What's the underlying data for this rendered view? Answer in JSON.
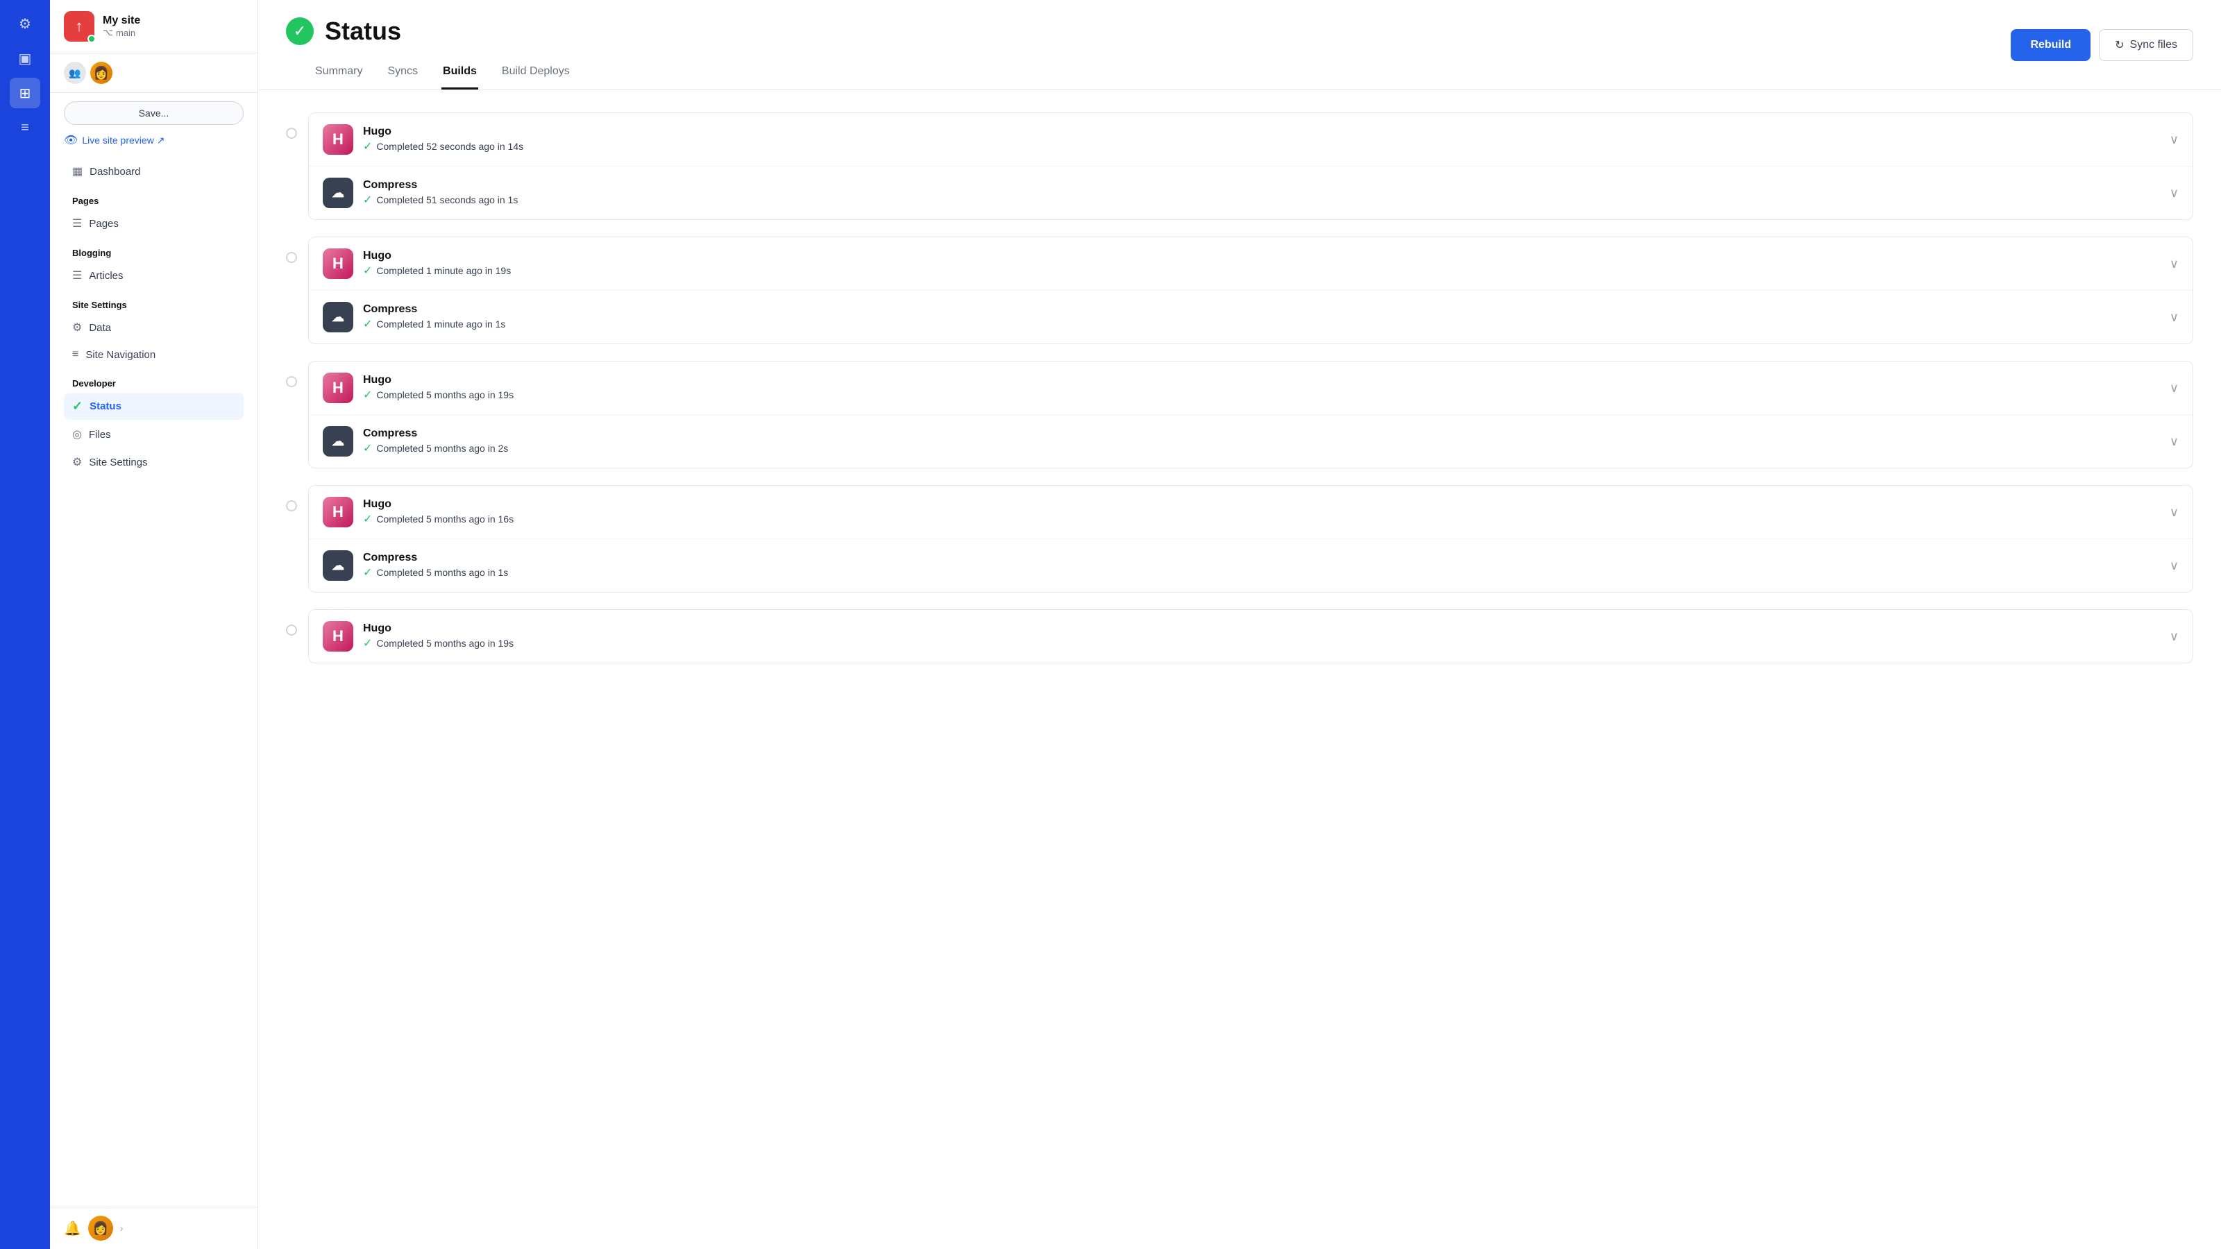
{
  "iconBar": {
    "items": [
      {
        "name": "gear-icon",
        "symbol": "⚙",
        "active": false
      },
      {
        "name": "layout-icon",
        "symbol": "▣",
        "active": false
      },
      {
        "name": "grid-icon",
        "symbol": "⊞",
        "active": true
      },
      {
        "name": "chart-icon",
        "symbol": "≡",
        "active": false
      }
    ]
  },
  "sidebar": {
    "siteName": "My site",
    "siteBranch": "main",
    "saveLabel": "Save...",
    "livePreviewLabel": "Live site preview ↗",
    "navSections": [
      {
        "label": "",
        "items": [
          {
            "name": "dashboard",
            "icon": "▦",
            "label": "Dashboard",
            "active": false
          }
        ]
      },
      {
        "label": "Pages",
        "items": [
          {
            "name": "pages",
            "icon": "☰",
            "label": "Pages",
            "active": false
          }
        ]
      },
      {
        "label": "Blogging",
        "items": [
          {
            "name": "articles",
            "icon": "☰",
            "label": "Articles",
            "active": false
          }
        ]
      },
      {
        "label": "Site Settings",
        "items": [
          {
            "name": "data",
            "icon": "⚙",
            "label": "Data",
            "active": false
          },
          {
            "name": "site-navigation",
            "icon": "≡",
            "label": "Site Navigation",
            "active": false
          }
        ]
      },
      {
        "label": "Developer",
        "items": [
          {
            "name": "status",
            "icon": "✓",
            "label": "Status",
            "active": true
          },
          {
            "name": "files",
            "icon": "◎",
            "label": "Files",
            "active": false
          },
          {
            "name": "site-settings",
            "icon": "⚙",
            "label": "Site Settings",
            "active": false
          }
        ]
      }
    ]
  },
  "header": {
    "pageTitle": "Status",
    "rebuildLabel": "Rebuild",
    "syncFilesLabel": "Sync files"
  },
  "tabs": [
    {
      "label": "Summary",
      "active": false
    },
    {
      "label": "Syncs",
      "active": false
    },
    {
      "label": "Builds",
      "active": true
    },
    {
      "label": "Build Deploys",
      "active": false
    }
  ],
  "builds": [
    {
      "steps": [
        {
          "type": "hugo",
          "name": "Hugo",
          "status": "Completed 52 seconds ago in 14s"
        },
        {
          "type": "compress",
          "name": "Compress",
          "status": "Completed 51 seconds ago in 1s"
        }
      ]
    },
    {
      "steps": [
        {
          "type": "hugo",
          "name": "Hugo",
          "status": "Completed 1 minute ago in 19s"
        },
        {
          "type": "compress",
          "name": "Compress",
          "status": "Completed 1 minute ago in 1s"
        }
      ]
    },
    {
      "steps": [
        {
          "type": "hugo",
          "name": "Hugo",
          "status": "Completed 5 months ago in 19s"
        },
        {
          "type": "compress",
          "name": "Compress",
          "status": "Completed 5 months ago in 2s"
        }
      ]
    },
    {
      "steps": [
        {
          "type": "hugo",
          "name": "Hugo",
          "status": "Completed 5 months ago in 16s"
        },
        {
          "type": "compress",
          "name": "Compress",
          "status": "Completed 5 months ago in 1s"
        }
      ]
    },
    {
      "steps": [
        {
          "type": "hugo",
          "name": "Hugo",
          "status": "Completed 5 months ago in 19s"
        }
      ]
    }
  ]
}
